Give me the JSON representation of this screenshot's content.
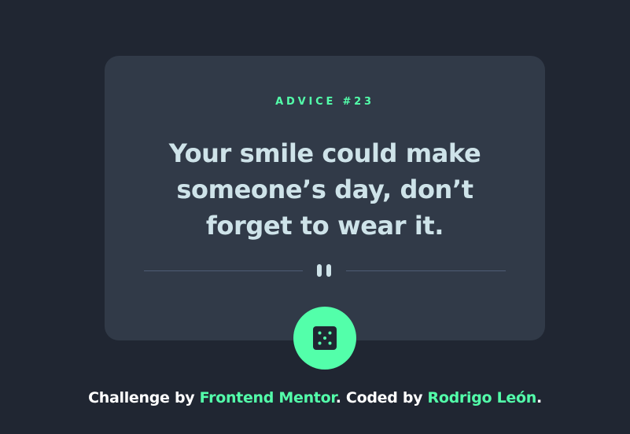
{
  "card": {
    "heading": "ADVICE #23",
    "quote": "Your smile could make someone’s day, don’t forget to wear it."
  },
  "button": {
    "icon": "dice-icon"
  },
  "footer": {
    "prefix": "Challenge by ",
    "link1": "Frontend Mentor",
    "middle": ". Coded by ",
    "link2": "Rodrigo León",
    "suffix": "."
  },
  "colors": {
    "background": "#202632",
    "card": "#313a48",
    "accent": "#53ffaa",
    "text": "#cee3e9",
    "divider": "#4f5d74"
  }
}
